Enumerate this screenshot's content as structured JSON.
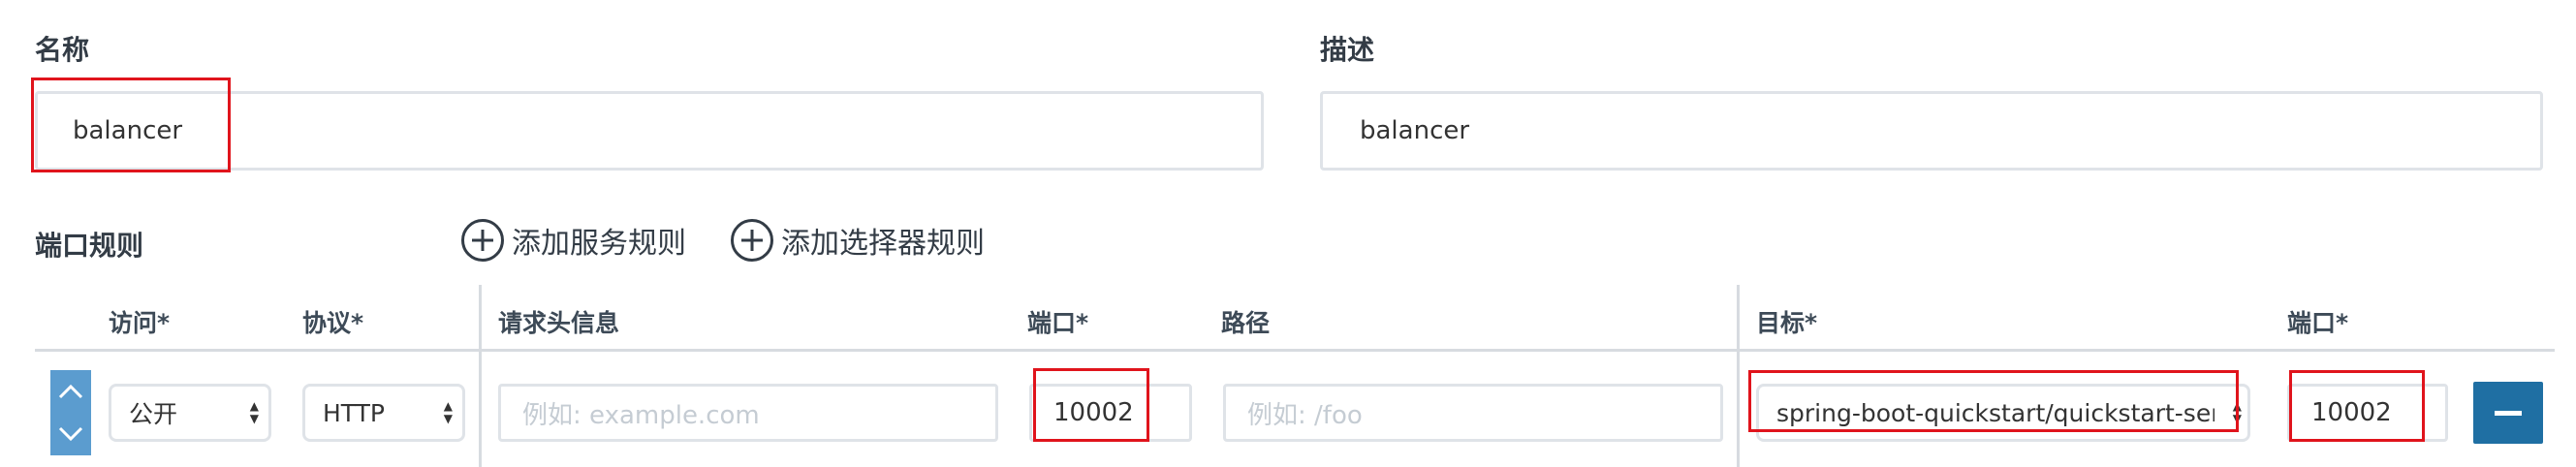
{
  "form": {
    "name_label": "名称",
    "name_value": "balancer",
    "description_label": "描述",
    "description_value": "balancer"
  },
  "port_rules": {
    "title": "端口规则",
    "add_service_rule": "添加服务规则",
    "add_selector_rule": "添加选择器规则",
    "headers": {
      "access": "访问*",
      "protocol": "协议*",
      "request_host": "请求头信息",
      "port": "端口*",
      "path": "路径",
      "target": "目标*",
      "target_port": "端口*"
    },
    "row": {
      "access": "公开",
      "protocol": "HTTP",
      "host_placeholder": "例如: example.com",
      "port": "10002",
      "path_placeholder": "例如: /foo",
      "target": "spring-boot-quickstart/quickstart-servic",
      "target_port": "10002"
    }
  },
  "colors": {
    "accent": "#1f6fa3",
    "handle": "#5b9ccf",
    "highlight": "#e0141c"
  }
}
